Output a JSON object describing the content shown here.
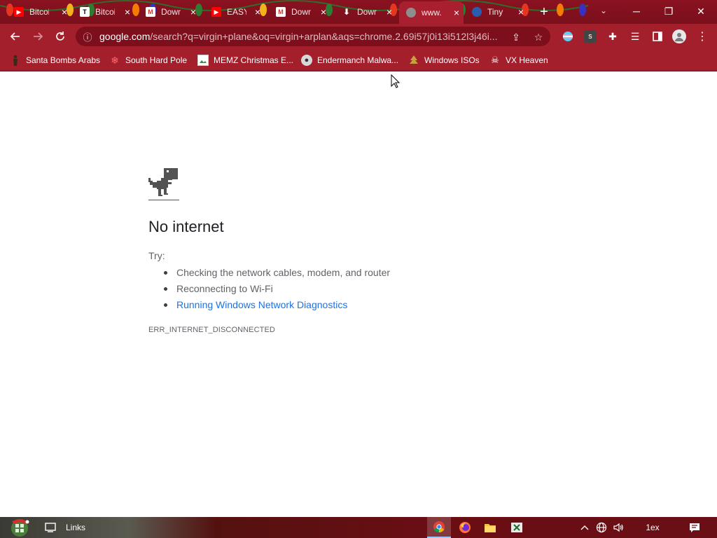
{
  "tabs": [
    {
      "title": "Bitcoi",
      "favicon": "youtube-icon",
      "color": "#ff0000",
      "glyph": "▶"
    },
    {
      "title": "Bitcoi",
      "favicon": "t-icon",
      "color": "#ffffff",
      "glyph": "T"
    },
    {
      "title": "Down",
      "favicon": "gmail-icon",
      "color": "#d93025",
      "glyph": "M"
    },
    {
      "title": "EASY",
      "favicon": "youtube-icon",
      "color": "#ff0000",
      "glyph": "▶"
    },
    {
      "title": "Down",
      "favicon": "gmail-icon",
      "color": "#d93025",
      "glyph": "M"
    },
    {
      "title": "Down",
      "favicon": "download-icon",
      "color": "#ffffff",
      "glyph": "⬇"
    },
    {
      "title": "www.",
      "favicon": "globe-icon",
      "color": "#9aa0a6",
      "glyph": "◍",
      "active": true
    },
    {
      "title": "Tiny",
      "favicon": "tinyurl-icon",
      "color": "#2a5db0",
      "glyph": "◉"
    }
  ],
  "toolbar": {
    "url_host": "google.com",
    "url_rest": "/search?q=virgin+plane&oq=virgin+arplan&aqs=chrome.2.69i57j0i13i512l3j46i..."
  },
  "bookmarks": [
    {
      "label": "Santa Bombs Arabs",
      "icon": "figure-icon"
    },
    {
      "label": "South Hard Pole",
      "icon": "snowflake-icon"
    },
    {
      "label": "MEMZ Christmas E...",
      "icon": "image-icon"
    },
    {
      "label": "Endermanch Malwa...",
      "icon": "raccoon-icon"
    },
    {
      "label": "Windows ISOs",
      "icon": "tree-icon"
    },
    {
      "label": "VX Heaven",
      "icon": "skull-icon"
    }
  ],
  "error": {
    "heading": "No internet",
    "try": "Try:",
    "suggestions": [
      "Checking the network cables, modem, and router",
      "Reconnecting to Wi-Fi",
      "Running Windows Network Diagnostics"
    ],
    "code": "ERR_INTERNET_DISCONNECTED"
  },
  "taskbar": {
    "links_label": "Links",
    "clock_text": "1ex"
  }
}
